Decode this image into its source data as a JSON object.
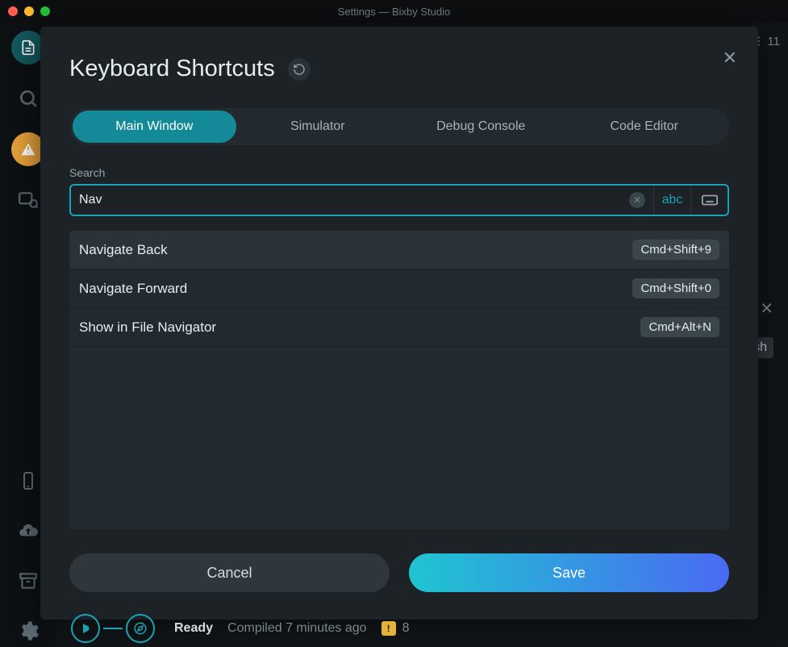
{
  "window": {
    "title": "Settings — Bixby Studio"
  },
  "topbar": {
    "count": "11"
  },
  "modal": {
    "title": "Keyboard Shortcuts",
    "tabs": [
      {
        "label": "Main Window",
        "active": true
      },
      {
        "label": "Simulator",
        "active": false
      },
      {
        "label": "Debug Console",
        "active": false
      },
      {
        "label": "Code Editor",
        "active": false
      }
    ],
    "search_label": "Search",
    "search_value": "Nav",
    "mode_abc": "abc",
    "results": [
      {
        "label": "Navigate Back",
        "shortcut": "Cmd+Shift+9"
      },
      {
        "label": "Navigate Forward",
        "shortcut": "Cmd+Shift+0"
      },
      {
        "label": "Show in File Navigator",
        "shortcut": "Cmd+Alt+N"
      }
    ],
    "cancel": "Cancel",
    "save": "Save"
  },
  "status": {
    "ready": "Ready",
    "compiled": "Compiled 7 minutes ago",
    "warn_count": "8"
  },
  "bg": {
    "sh": "sh"
  }
}
